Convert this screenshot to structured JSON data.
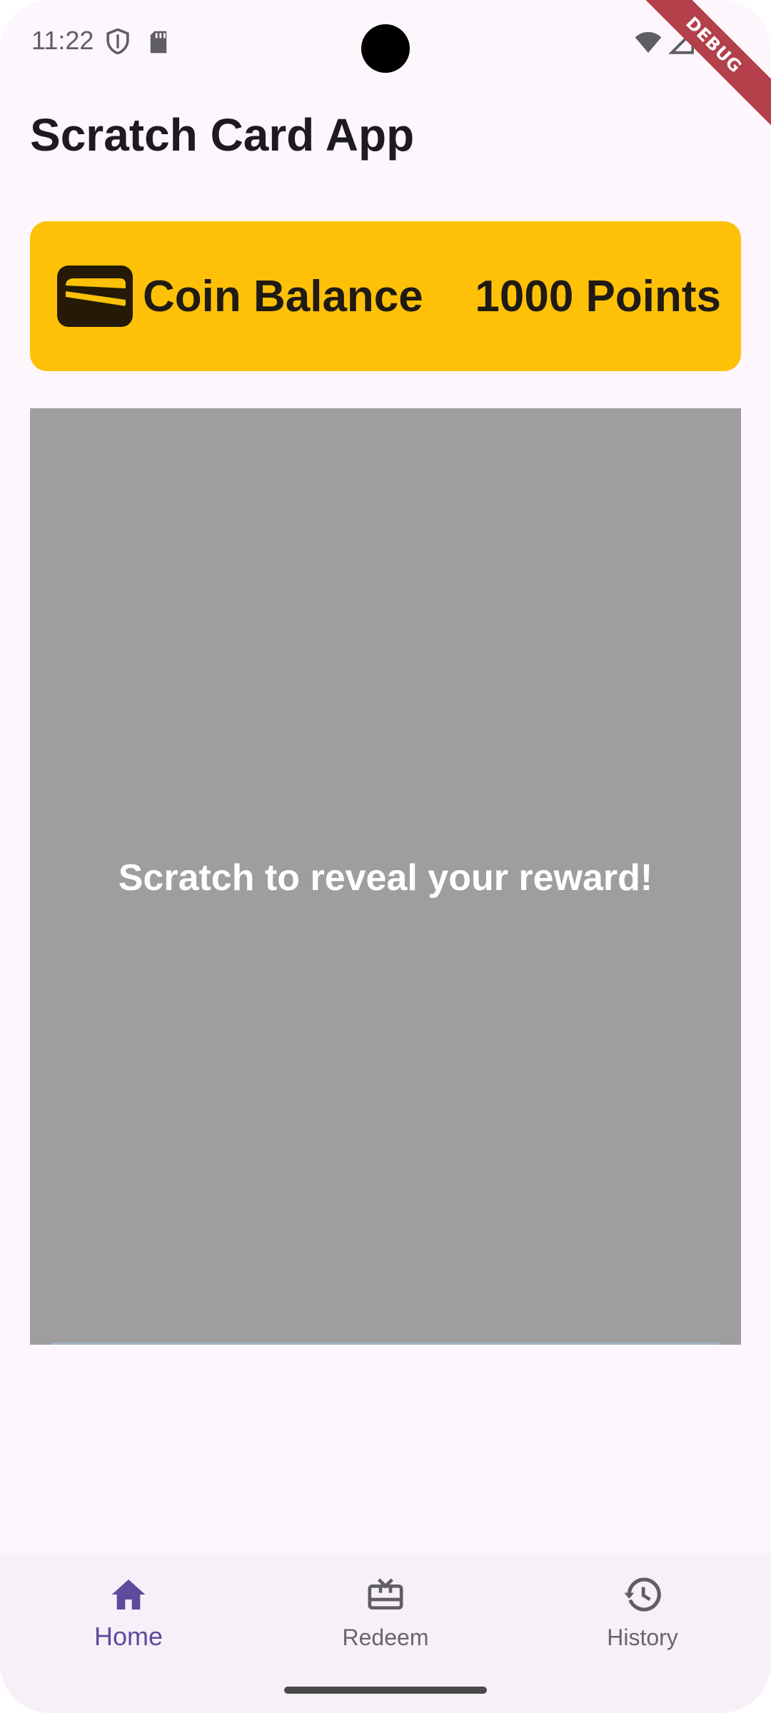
{
  "status_bar": {
    "time": "11:22",
    "icons": [
      "shield-icon",
      "sd-card-icon",
      "wifi-icon",
      "signal-icon",
      "battery-icon"
    ]
  },
  "debug_banner": "DEBUG",
  "app_bar": {
    "title": "Scratch Card App"
  },
  "coin_card": {
    "icon": "wallet-icon",
    "label": "Coin Balance",
    "value": "1000 Points",
    "background": "#fec107"
  },
  "scratch_card": {
    "prompt": "Scratch to reveal your reward!",
    "cover_color": "#9e9e9e"
  },
  "bottom_nav": {
    "items": [
      {
        "label": "Home",
        "icon": "home-icon",
        "active": true
      },
      {
        "label": "Redeem",
        "icon": "gift-card-icon",
        "active": false
      },
      {
        "label": "History",
        "icon": "history-icon",
        "active": false
      }
    ],
    "active_color": "#5d4c9c"
  }
}
